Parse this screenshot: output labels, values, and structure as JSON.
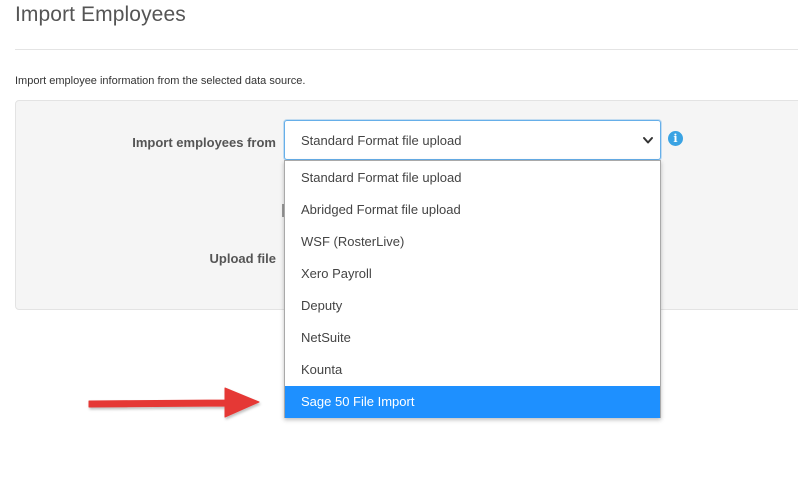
{
  "page": {
    "title": "Import Employees",
    "intro": "Import employee information from the selected data source."
  },
  "form": {
    "import_from_label": "Import employees from",
    "upload_file_label": "Upload file",
    "select": {
      "value": "Standard Format file upload",
      "info_icon": "info-icon"
    }
  },
  "dropdown": {
    "options": [
      "Standard Format file upload",
      "Abridged Format file upload",
      "WSF (RosterLive)",
      "Xero Payroll",
      "Deputy",
      "NetSuite",
      "Kounta",
      "Sage 50 File Import"
    ],
    "highlighted_option": "Sage 50 File Import"
  },
  "colors": {
    "highlight": "#1e90ff",
    "focus_border": "#66afe9",
    "info_icon": "#3aa3e3",
    "annotation_arrow": "#e53935"
  }
}
